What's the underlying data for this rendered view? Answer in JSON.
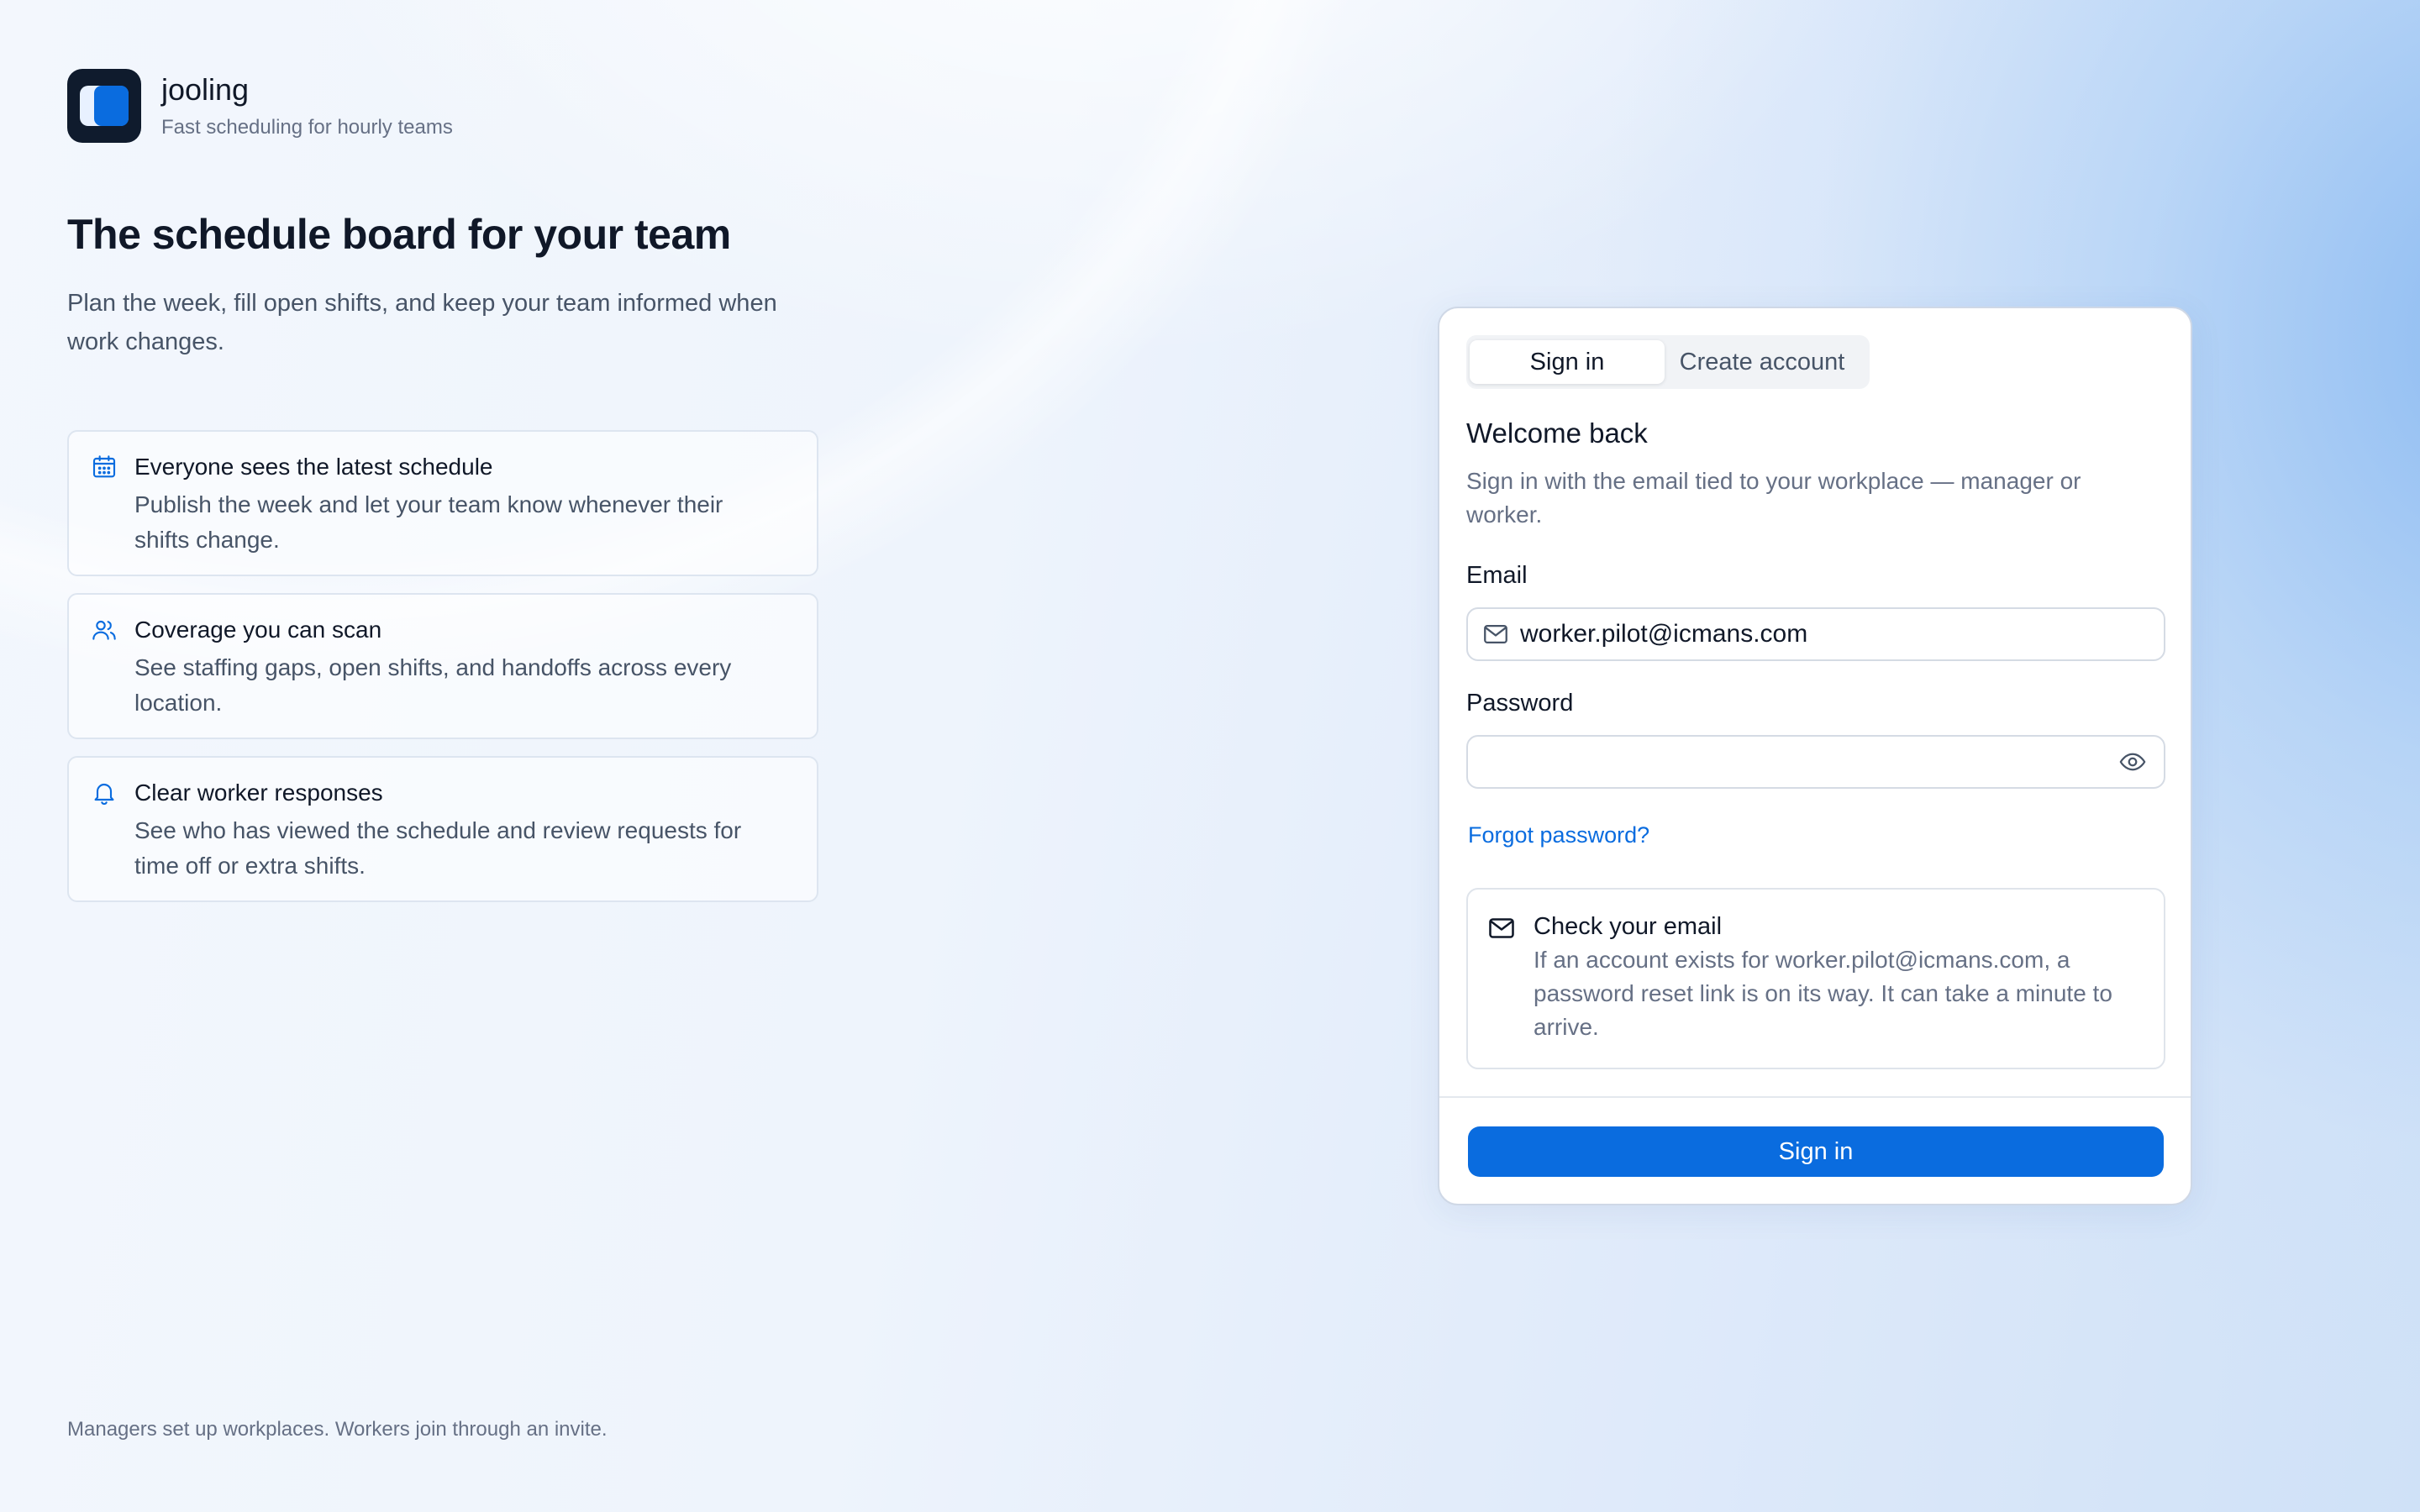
{
  "brand": {
    "name": "jooling",
    "tagline": "Fast scheduling for hourly teams"
  },
  "hero": {
    "title": "The schedule board for your team",
    "subtitle": "Plan the week, fill open shifts, and keep your team informed when work changes."
  },
  "features": [
    {
      "icon": "calendar-icon",
      "title": "Everyone sees the latest schedule",
      "description": "Publish the week and let your team know whenever their shifts change."
    },
    {
      "icon": "users-icon",
      "title": "Coverage you can scan",
      "description": "See staffing gaps, open shifts, and handoffs across every location."
    },
    {
      "icon": "bell-icon",
      "title": "Clear worker responses",
      "description": "See who has viewed the schedule and review requests for time off or extra shifts."
    }
  ],
  "footer": {
    "note": "Managers set up workplaces. Workers join through an invite."
  },
  "auth": {
    "tabs": {
      "sign_in": "Sign in",
      "create_account": "Create account",
      "active": "sign_in"
    },
    "heading": "Welcome back",
    "subheading": "Sign in with the email tied to your workplace — manager or worker.",
    "email": {
      "label": "Email",
      "value": "worker.pilot@icmans.com",
      "icon": "mail-icon"
    },
    "password": {
      "label": "Password",
      "value": "",
      "toggle_icon": "eye-icon"
    },
    "forgot_link": "Forgot password?",
    "notice": {
      "icon": "mail-icon",
      "title": "Check your email",
      "body": "If an account exists for worker.pilot@icmans.com, a password reset link is on its way. It can take a minute to arrive."
    },
    "submit_label": "Sign in"
  },
  "colors": {
    "accent": "#0a6cdf",
    "text_primary": "#101828",
    "text_secondary": "#475467",
    "text_muted": "#667085",
    "logo_bg": "#0f1b2d"
  }
}
